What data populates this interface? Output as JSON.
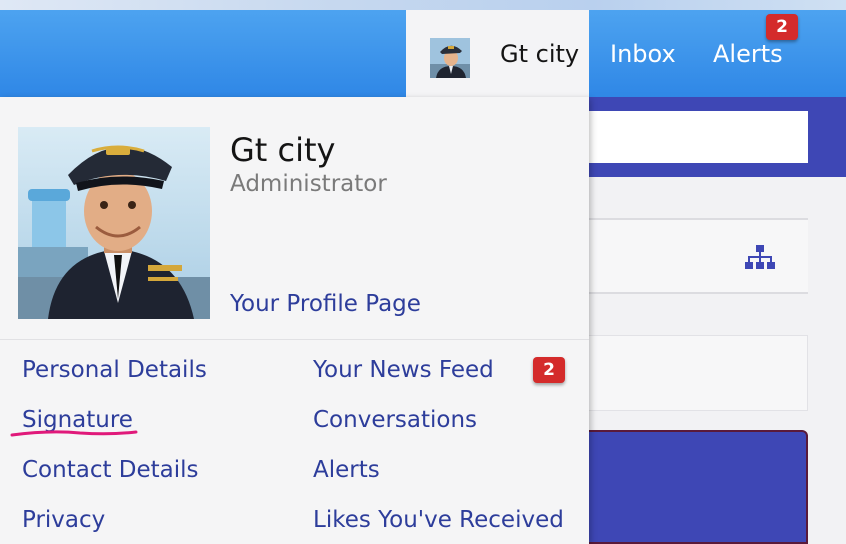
{
  "header": {
    "username": "Gt city",
    "nav": {
      "inbox": "Inbox",
      "alerts": "Alerts",
      "alerts_count": "2"
    }
  },
  "profile": {
    "name": "Gt city",
    "role": "Administrator",
    "profile_link": "Your Profile Page"
  },
  "menu": {
    "left": [
      "Personal Details",
      "Signature",
      "Contact Details",
      "Privacy"
    ],
    "right": [
      "Your News Feed",
      "Conversations",
      "Alerts",
      "Likes You've Received"
    ],
    "alerts_count": "2"
  },
  "icons": {
    "sitemap": "sitemap-icon",
    "avatar": "pilot-avatar"
  },
  "colors": {
    "header_blue": "#2f87e6",
    "link_blue": "#2d3d9b",
    "badge_red": "#d42b2b",
    "band_indigo": "#3e47b5",
    "highlight_pink": "#e0197a"
  }
}
